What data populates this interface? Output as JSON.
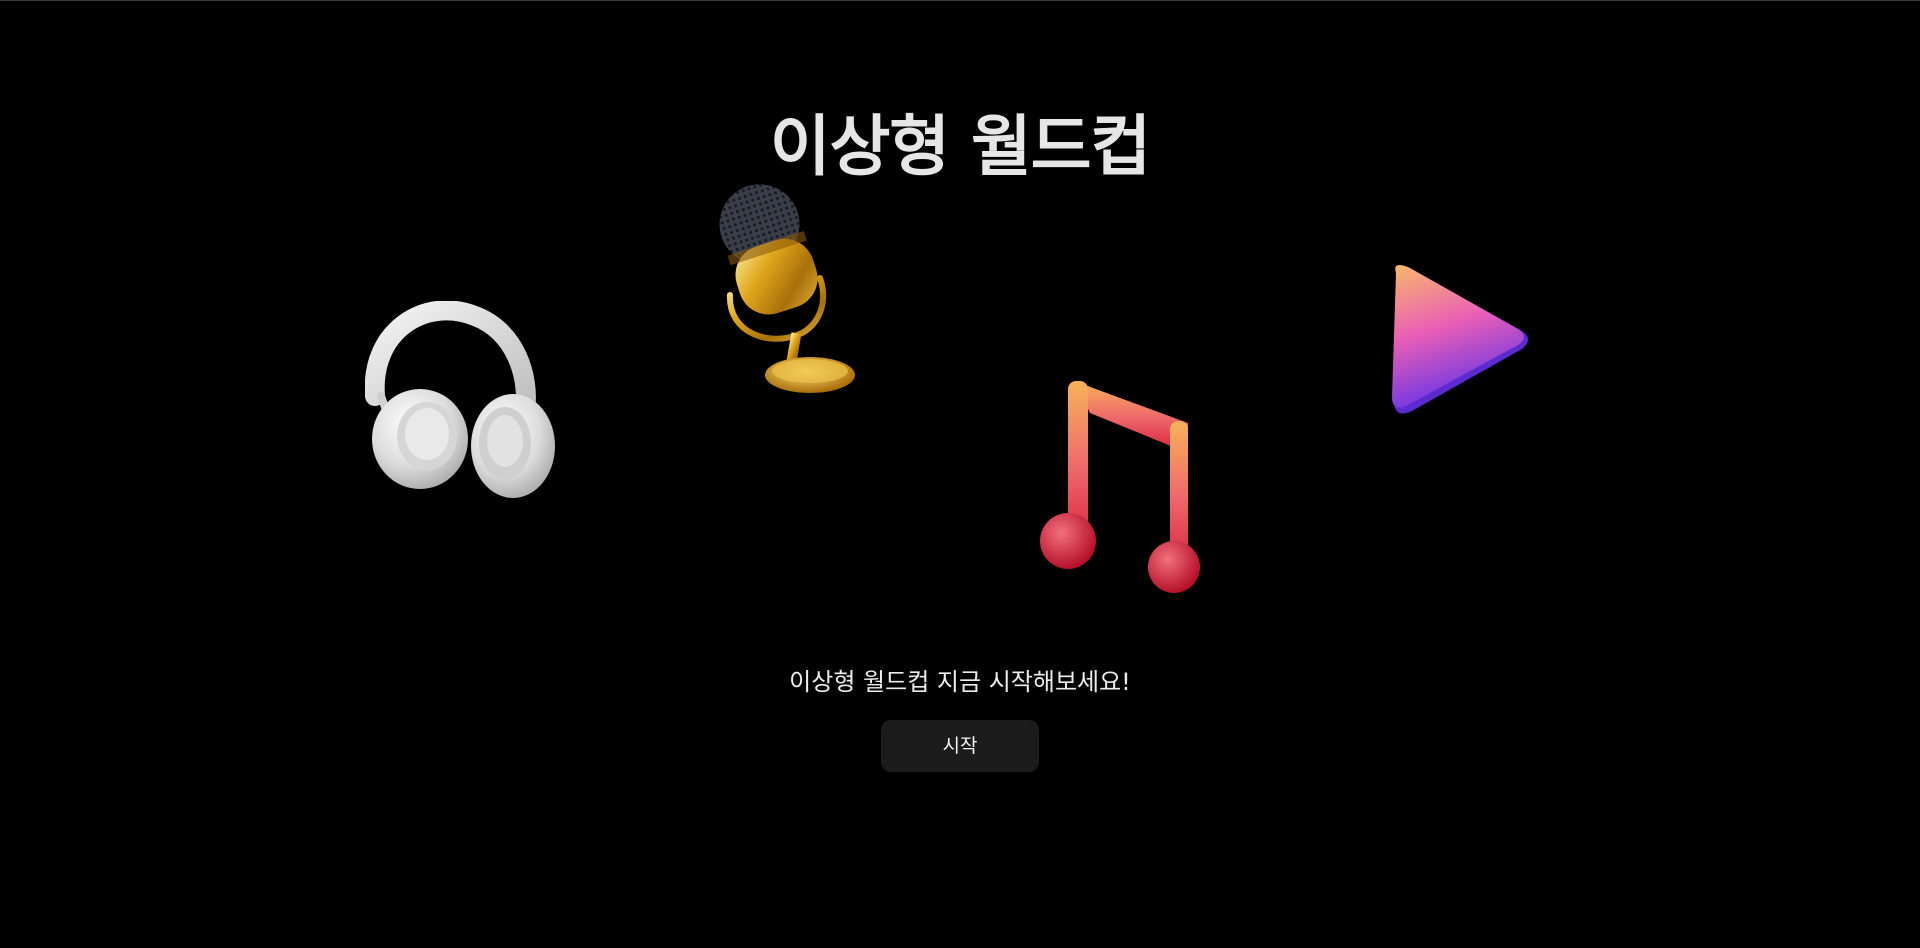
{
  "header": {
    "title": "이상형 월드컵"
  },
  "decorations": [
    {
      "icon": "headphones-icon",
      "color": "#e8e8e8"
    },
    {
      "icon": "microphone-icon",
      "color": "#d4a017"
    },
    {
      "icon": "music-note-icon",
      "color": "#e8405a"
    },
    {
      "icon": "play-icon",
      "color": "#b14ae8"
    }
  ],
  "main": {
    "subtitle": "이상형 월드컵 지금 시작해보세요!",
    "start_label": "시작"
  },
  "colors": {
    "background": "#000000",
    "button": "#1c1c1c",
    "text": "#e6e6e6"
  }
}
